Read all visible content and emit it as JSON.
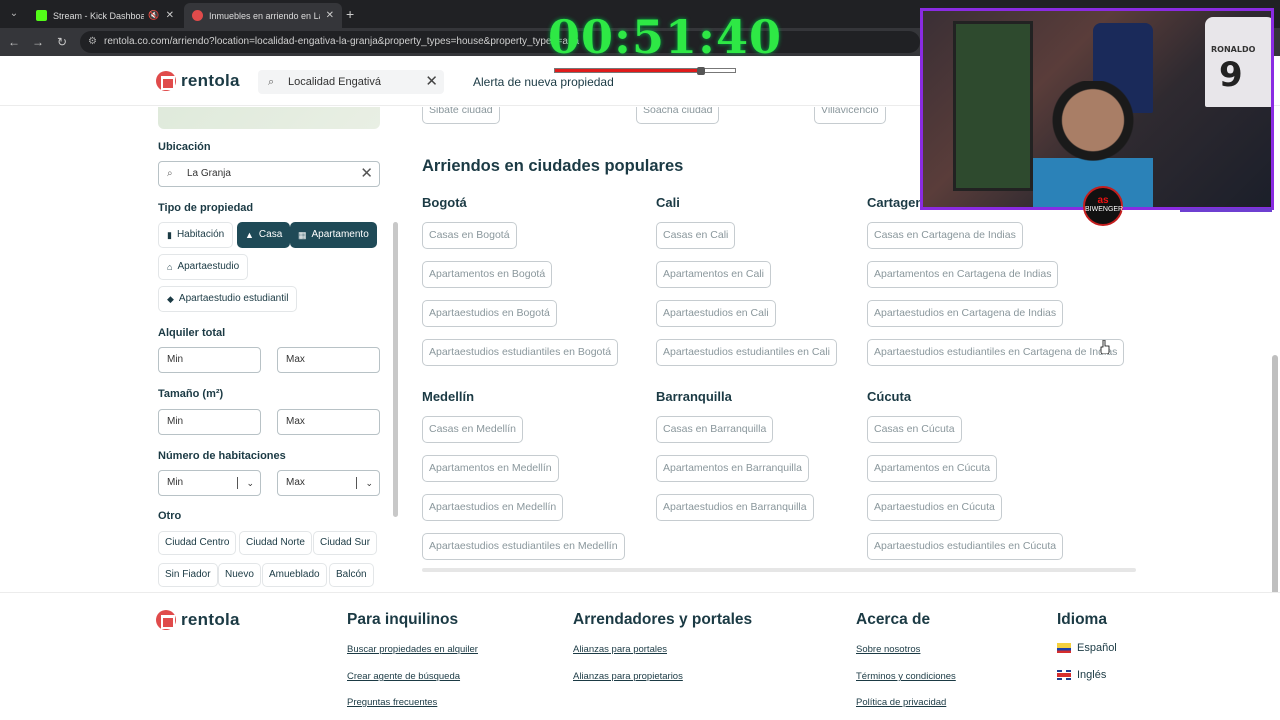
{
  "browser": {
    "tabs": [
      {
        "title": "Stream - Kick Dashboard",
        "favicon_color": "#53fc18"
      },
      {
        "title": "Inmuebles en arriendo en La Gr",
        "favicon_color": "#e04b4b"
      }
    ],
    "url": "rentola.co.com/arriendo?location=localidad-engativa-la-granja&property_types=house&property_types=apa"
  },
  "overlay": {
    "timer": "00:51:40",
    "progress_fraction": 0.81,
    "badge_top": "as",
    "badge_bottom": "BIWENGER",
    "jersey_name": "RONALDO",
    "jersey_number": "9"
  },
  "header": {
    "logo": "rentola",
    "search_value": "Localidad Engativá",
    "alert_label": "Alerta de nueva propiedad"
  },
  "filters": {
    "location_label": "Ubicación",
    "location_value": "La Granja",
    "property_type_label": "Tipo de propiedad",
    "property_types": [
      {
        "label": "Habitación",
        "selected": false
      },
      {
        "label": "Casa",
        "selected": true
      },
      {
        "label": "Apartamento",
        "selected": true
      },
      {
        "label": "Apartaestudio",
        "selected": false
      },
      {
        "label": "Apartaestudio estudiantil",
        "selected": false
      }
    ],
    "total_rent_label": "Alquiler total",
    "size_label": "Tamaño (m²)",
    "rooms_label": "Número de habitaciones",
    "min_placeholder": "Min",
    "max_placeholder": "Max",
    "other_label": "Otro",
    "other_options": [
      "Ciudad Centro",
      "Ciudad Norte",
      "Ciudad Sur",
      "Sin Fiador",
      "Nuevo",
      "Amueblado",
      "Balcón"
    ]
  },
  "main": {
    "top_chips": [
      "Sibaté ciudad",
      "Soacha ciudad",
      "Villavicencio"
    ],
    "section_title": "Arriendos en ciudades populares",
    "cities": [
      {
        "name": "Bogotá",
        "links": [
          "Casas en Bogotá",
          "Apartamentos en Bogotá",
          "Apartaestudios en Bogotá",
          "Apartaestudios estudiantiles en Bogotá"
        ]
      },
      {
        "name": "Cali",
        "links": [
          "Casas en Cali",
          "Apartamentos en Cali",
          "Apartaestudios en Cali",
          "Apartaestudios estudiantiles en Cali"
        ]
      },
      {
        "name": "Cartagena de Indias",
        "links": [
          "Casas en Cartagena de Indias",
          "Apartamentos en Cartagena de Indias",
          "Apartaestudios en Cartagena de Indias",
          "Apartaestudios estudiantiles en Cartagena de Indias"
        ]
      },
      {
        "name": "Medellín",
        "links": [
          "Casas en Medellín",
          "Apartamentos en Medellín",
          "Apartaestudios en Medellín",
          "Apartaestudios estudiantiles en Medellín"
        ]
      },
      {
        "name": "Barranquilla",
        "links": [
          "Casas en Barranquilla",
          "Apartamentos en Barranquilla",
          "Apartaestudios en Barranquilla"
        ]
      },
      {
        "name": "Cúcuta",
        "links": [
          "Casas en Cúcuta",
          "Apartamentos en Cúcuta",
          "Apartaestudios en Cúcuta",
          "Apartaestudios estudiantiles en Cúcuta"
        ]
      }
    ]
  },
  "footer": {
    "logo": "rentola",
    "tenants": {
      "title": "Para inquilinos",
      "links": [
        "Buscar propiedades en alquiler",
        "Crear agente de búsqueda",
        "Preguntas frecuentes"
      ]
    },
    "landlords": {
      "title": "Arrendadores y portales",
      "links": [
        "Alianzas para portales",
        "Alianzas para propietarios"
      ]
    },
    "about": {
      "title": "Acerca de",
      "links": [
        "Sobre nosotros",
        "Términos y condiciones",
        "Política de privacidad"
      ]
    },
    "language": {
      "title": "Idioma",
      "options": [
        "Español",
        "Inglés"
      ]
    }
  }
}
